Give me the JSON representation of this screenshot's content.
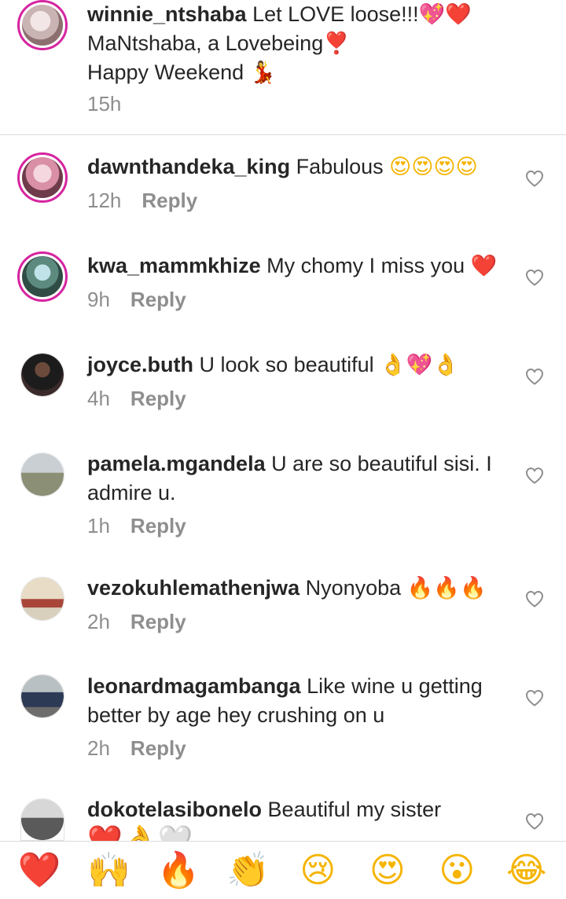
{
  "caption": {
    "username": "winnie_ntshaba",
    "line1": "Let LOVE loose!!!",
    "line1_emoji": "💖❤️",
    "line2": "MaNtshaba, a Lovebeing",
    "line2_emoji": "❣️",
    "line3": "Happy Weekend",
    "line3_emoji": "💃",
    "time": "15h"
  },
  "comments": [
    {
      "username": "dawnthandeka_king",
      "text": "Fabulous",
      "emoji": "😍😍😍😍",
      "time": "12h",
      "reply": "Reply"
    },
    {
      "username": "kwa_mammkhize",
      "text": "My chomy I miss you",
      "emoji": "❤️",
      "time": "9h",
      "reply": "Reply"
    },
    {
      "username": "joyce.buth",
      "text": "U look so beautiful",
      "emoji": "👌💖👌",
      "time": "4h",
      "reply": "Reply"
    },
    {
      "username": "pamela.mgandela",
      "text": "U are so beautiful sisi. I",
      "text2": "admire u.",
      "time": "1h",
      "reply": "Reply"
    },
    {
      "username": "vezokuhlemathenjwa",
      "text": "Nyonyoba",
      "emoji": "🔥🔥🔥",
      "time": "2h",
      "reply": "Reply"
    },
    {
      "username": "leonardmagambanga",
      "text": "Like wine u getting",
      "text2": "better by age hey crushing  on u",
      "time": "2h",
      "reply": "Reply"
    },
    {
      "username": "dokotelasibonelo",
      "text": "Beautiful my sister",
      "emoji2": "❤️👌🤍"
    }
  ],
  "emoji_bar": [
    "❤️",
    "🙌",
    "🔥",
    "👏",
    "😢",
    "😍",
    "😮",
    "😂"
  ],
  "colors": {
    "avatar_ring": "#d6249f",
    "meta_text": "#8e8e8e",
    "primary_text": "#262626"
  }
}
